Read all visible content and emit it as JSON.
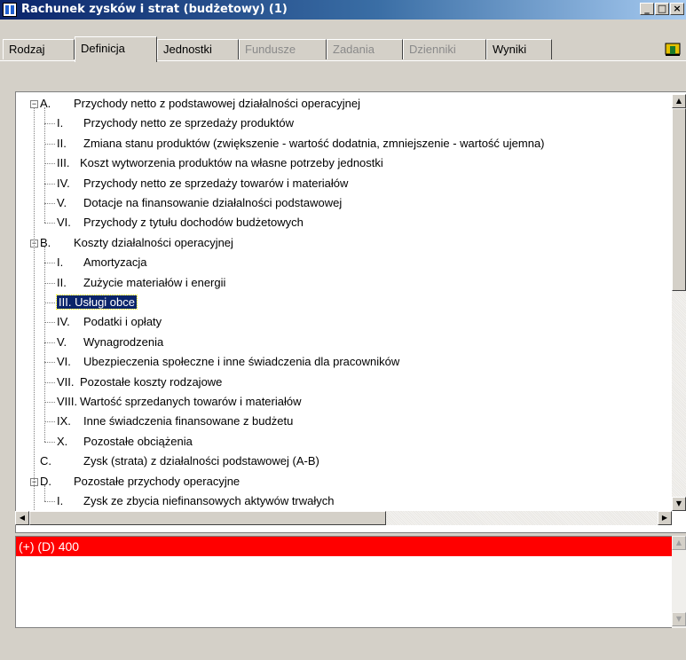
{
  "window": {
    "title": "Rachunek zysków i strat (budżetowy) (1)",
    "buttons": [
      "_",
      "□",
      "×"
    ]
  },
  "tabs": [
    {
      "label": "Rodzaj",
      "state": "normal"
    },
    {
      "label": "Definicja",
      "state": "active"
    },
    {
      "label": "Jednostki",
      "state": "normal"
    },
    {
      "label": "Fundusze",
      "state": "disabled"
    },
    {
      "label": "Zadania",
      "state": "disabled"
    },
    {
      "label": "Dzienniki",
      "state": "disabled"
    },
    {
      "label": "Wyniki",
      "state": "normal"
    }
  ],
  "exit_icon": "exit-door-icon",
  "tree": {
    "rows": [
      {
        "level": 0,
        "code": "A.",
        "text": "Przychody netto z podstawowej działalności operacyjnej",
        "expander": "collapse"
      },
      {
        "level": 1,
        "code": "I.",
        "text": "Przychody netto ze sprzedaży produktów"
      },
      {
        "level": 1,
        "code": "II.",
        "text": "Zmiana stanu produktów (zwiększenie - wartość dodatnia, zmniejszenie - wartość ujemna)"
      },
      {
        "level": 1,
        "code": "III.",
        "text": "Koszt wytworzenia produktów na własne potrzeby jednostki"
      },
      {
        "level": 1,
        "code": "IV.",
        "text": "Przychody netto ze sprzedaży towarów i materiałów"
      },
      {
        "level": 1,
        "code": "V.",
        "text": "Dotacje na finansowanie działalności podstawowej"
      },
      {
        "level": 1,
        "code": "VI.",
        "text": "Przychody z tytułu dochodów budżetowych"
      },
      {
        "level": 0,
        "code": "B.",
        "text": "Koszty działalności operacyjnej",
        "expander": "collapse"
      },
      {
        "level": 1,
        "code": "I.",
        "text": "Amortyzacja"
      },
      {
        "level": 1,
        "code": "II.",
        "text": "Zużycie materiałów i energii"
      },
      {
        "level": 1,
        "code": "III.",
        "text": "Usługi obce",
        "selected": true
      },
      {
        "level": 1,
        "code": "IV.",
        "text": "Podatki i opłaty"
      },
      {
        "level": 1,
        "code": "V.",
        "text": "Wynagrodzenia"
      },
      {
        "level": 1,
        "code": "VI.",
        "text": "Ubezpieczenia społeczne i inne świadczenia dla pracowników"
      },
      {
        "level": 1,
        "code": "VII.",
        "text": "Pozostałe koszty rodzajowe"
      },
      {
        "level": 1,
        "code": "VIII.",
        "text": "Wartość sprzedanych towarów i materiałów"
      },
      {
        "level": 1,
        "code": "IX.",
        "text": "Inne świadczenia finansowane z budżetu"
      },
      {
        "level": 1,
        "code": "X.",
        "text": "Pozostałe obciążenia"
      },
      {
        "level": 0,
        "code": "C.",
        "text": "Zysk (strata) z działalności podstawowej (A-B)"
      },
      {
        "level": 0,
        "code": "D.",
        "text": "Pozostałe przychody operacyjne",
        "expander": "collapse"
      },
      {
        "level": 1,
        "code": "I.",
        "text": "Zysk ze zbycia niefinansowych aktywów trwałych"
      }
    ]
  },
  "bottom": {
    "items": [
      "(+) (D) 400"
    ],
    "highlight_color": "#ff0000"
  },
  "colors": {
    "titlebar_start": "#0a246a",
    "selection_bg": "#0a246a",
    "panel_bg": "#d4d0c8"
  }
}
